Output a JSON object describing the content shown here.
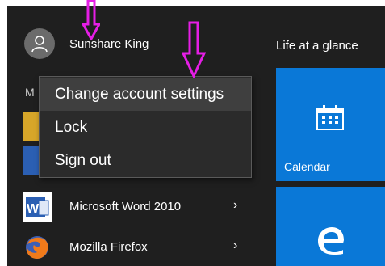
{
  "user": {
    "name": "Sunshare King",
    "avatar_icon": "person-icon"
  },
  "live_tiles_header": "Life at a glance",
  "section_letter": "M",
  "context_menu": {
    "items": [
      {
        "label": "Change account settings",
        "highlighted": true
      },
      {
        "label": "Lock",
        "highlighted": false
      },
      {
        "label": "Sign out",
        "highlighted": false
      }
    ]
  },
  "apps": [
    {
      "label": "Microsoft Word 2010",
      "icon": "word-icon",
      "chevron": "›"
    },
    {
      "label": "Mozilla Firefox",
      "icon": "firefox-icon",
      "chevron": "›"
    }
  ],
  "tiles": {
    "calendar": {
      "label": "Calendar",
      "icon": "calendar-icon"
    },
    "edge": {
      "icon": "edge-icon"
    }
  },
  "colors": {
    "start_background": "#1f1f1f",
    "tile_blue": "#0a78d7",
    "annotation_arrow": "#e61ee6"
  }
}
